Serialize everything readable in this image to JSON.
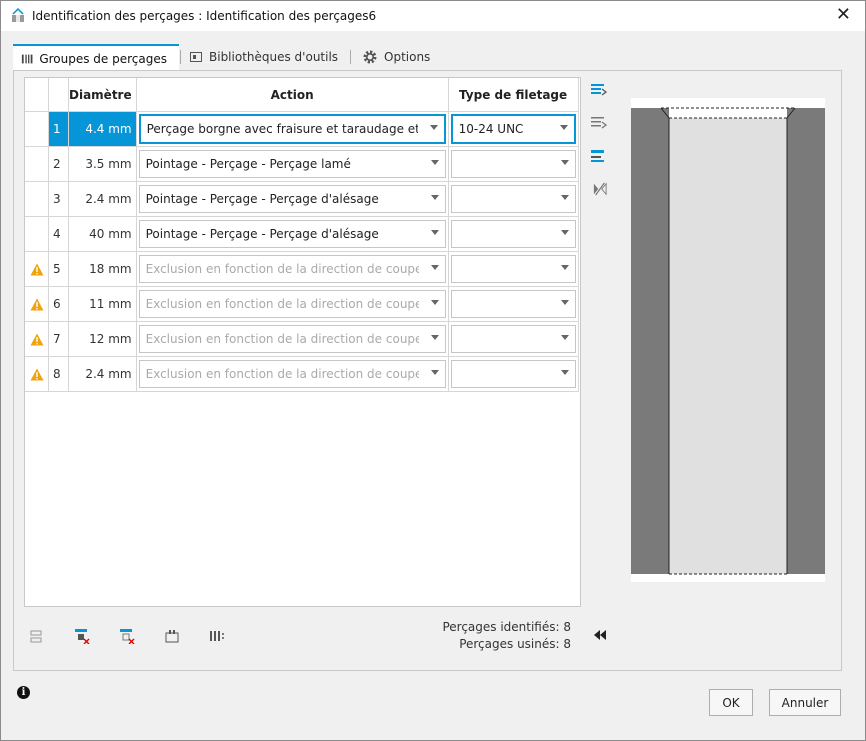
{
  "window": {
    "title": "Identification des perçages : Identification des perçages6",
    "close_glyph": "✕"
  },
  "tabs": [
    {
      "label": "Groupes de perçages",
      "icon": "hole-groups-icon"
    },
    {
      "label": "Bibliothèques d'outils",
      "icon": "tool-library-icon"
    },
    {
      "label": "Options",
      "icon": "gear-icon"
    }
  ],
  "table": {
    "headers": {
      "diameter": "Diamètre",
      "action": "Action",
      "thread": "Type de filetage"
    },
    "rows": [
      {
        "num": "1",
        "diameter": "4.4 mm",
        "action": "Perçage borgne avec fraisure et taraudage et pe",
        "thread": "10-24 UNC",
        "warning": false,
        "selected": true
      },
      {
        "num": "2",
        "diameter": "3.5 mm",
        "action": "Pointage - Perçage - Perçage lamé",
        "thread": "",
        "warning": false
      },
      {
        "num": "3",
        "diameter": "2.4 mm",
        "action": "Pointage - Perçage - Perçage d'alésage",
        "thread": "",
        "warning": false
      },
      {
        "num": "4",
        "diameter": "40 mm",
        "action": "Pointage - Perçage - Perçage d'alésage",
        "thread": "",
        "warning": false
      },
      {
        "num": "5",
        "diameter": "18 mm",
        "action": "Exclusion en fonction de la direction de coupe.",
        "thread": "",
        "warning": true
      },
      {
        "num": "6",
        "diameter": "11 mm",
        "action": "Exclusion en fonction de la direction de coupe.",
        "thread": "",
        "warning": true
      },
      {
        "num": "7",
        "diameter": "12 mm",
        "action": "Exclusion en fonction de la direction de coupe.",
        "thread": "",
        "warning": true
      },
      {
        "num": "8",
        "diameter": "2.4 mm",
        "action": "Exclusion en fonction de la direction de coupe.",
        "thread": "",
        "warning": true
      }
    ]
  },
  "stats": {
    "identified": "Perçages identifiés: 8",
    "machined": "Perçages usinés: 8"
  },
  "buttons": {
    "ok": "OK",
    "cancel": "Annuler"
  },
  "colors": {
    "accent": "#0696d7",
    "warning": "#f0a30a",
    "preview_wall": "#7a7a7a",
    "preview_hole": "#e0e0e0"
  }
}
